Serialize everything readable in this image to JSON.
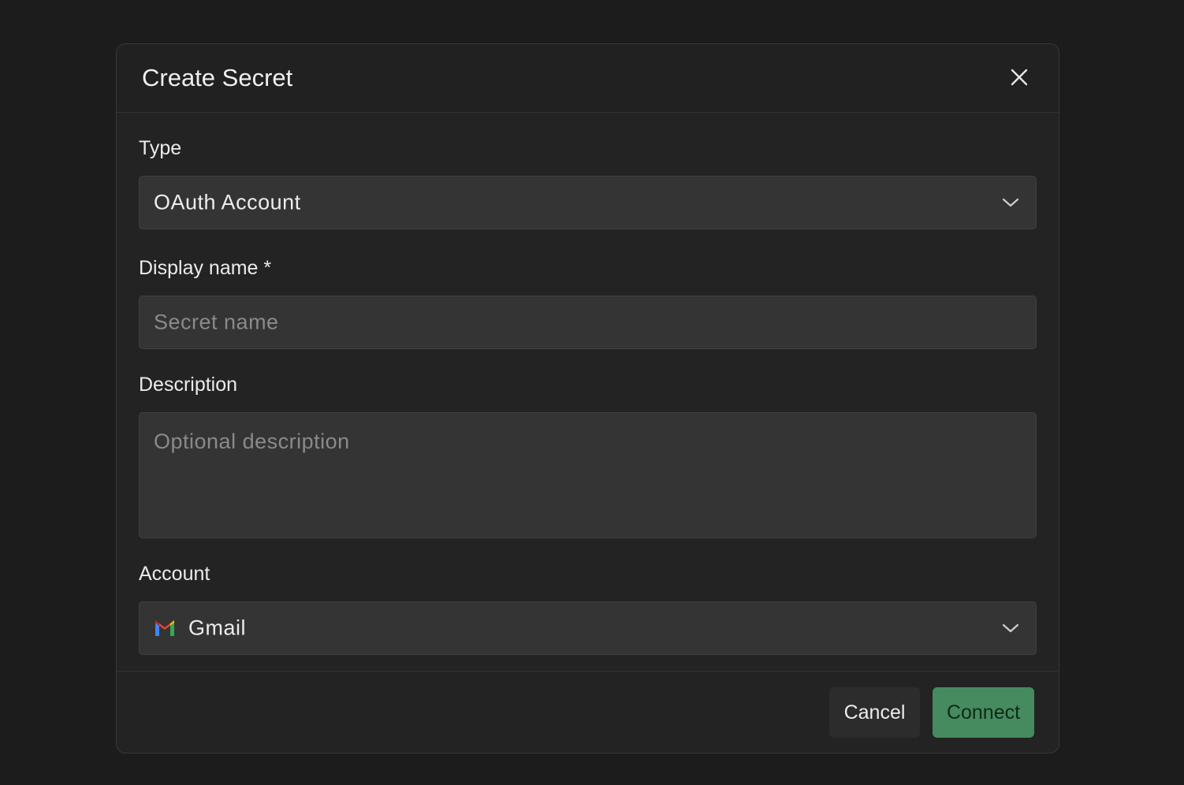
{
  "dialog": {
    "title": "Create Secret"
  },
  "fields": {
    "type": {
      "label": "Type",
      "value": "OAuth Account"
    },
    "display_name": {
      "label": "Display name *",
      "placeholder": "Secret name",
      "value": ""
    },
    "description": {
      "label": "Description",
      "placeholder": "Optional description",
      "value": ""
    },
    "account": {
      "label": "Account",
      "value": "Gmail",
      "icon": "gmail-icon"
    }
  },
  "footer": {
    "cancel_label": "Cancel",
    "connect_label": "Connect"
  },
  "colors": {
    "page_background": "#1c1c1c",
    "dialog_background": "#232323",
    "field_background": "#343434",
    "connect_button": "#468a5f"
  }
}
